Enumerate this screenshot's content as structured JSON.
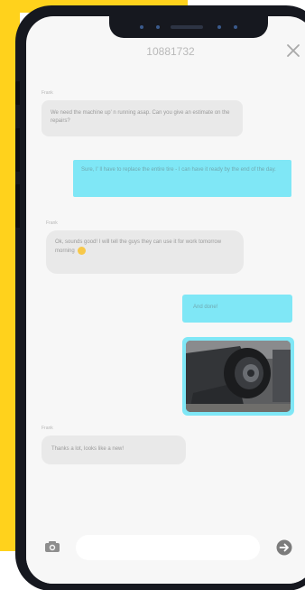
{
  "chat": {
    "title": "10881732"
  },
  "messages": [
    {
      "direction": "incoming",
      "sender": "Frank",
      "text": "We need the machine up' n running asap. Can you give an estimate on the repairs?"
    },
    {
      "direction": "outgoing",
      "text": "Sure, I' ll have to replace the entire tire - I can have it ready by the end of the day."
    },
    {
      "direction": "incoming",
      "sender": "Frank",
      "text": "Ok, sounds good! I will tell the guys they can use it for work tomorrow morning",
      "emoji": "smiley-face"
    },
    {
      "direction": "outgoing",
      "text": "And done!"
    },
    {
      "direction": "outgoing",
      "type": "image",
      "image_subject": "repaired tractor tire"
    },
    {
      "direction": "incoming",
      "sender": "Frank",
      "text": "Thanks a lot, looks like a new!"
    }
  ],
  "composer": {
    "placeholder": "",
    "value": ""
  },
  "icons": {
    "close": "close-icon",
    "camera": "camera-icon",
    "send": "send-arrow-icon"
  },
  "colors": {
    "background_accent": "#ffd21c",
    "outgoing_bubble": "#7fe7f6",
    "incoming_bubble": "#e9e9e9",
    "phone_frame": "#16181f"
  }
}
